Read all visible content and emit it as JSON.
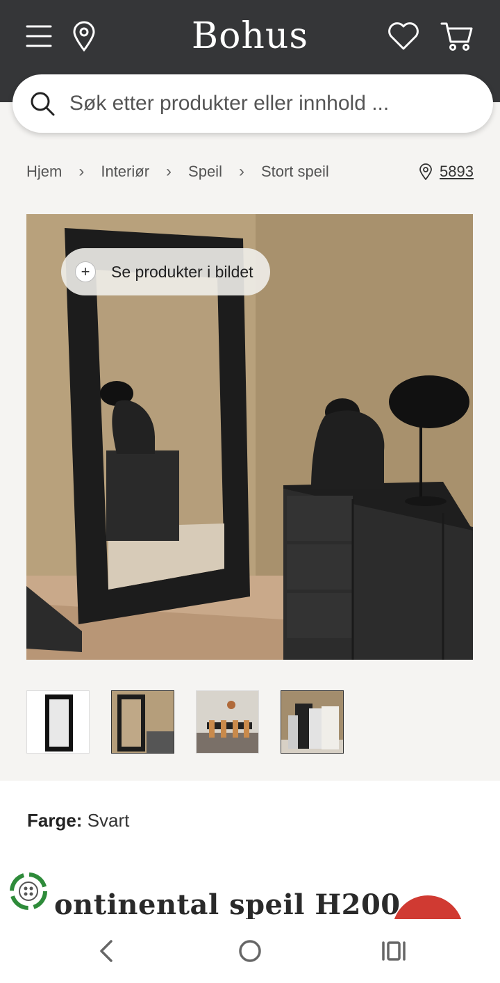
{
  "header": {
    "logo_text": "Bohus",
    "menu_icon": "menu-icon",
    "location_icon": "map-pin-icon",
    "wishlist_icon": "heart-icon",
    "cart_icon": "cart-icon"
  },
  "search": {
    "placeholder": "Søk etter produkter eller innhold ..."
  },
  "breadcrumb": {
    "items": [
      "Hjem",
      "Interiør",
      "Speil",
      "Stort speil"
    ],
    "store_number": "5893"
  },
  "hero": {
    "pill_label": "Se produkter i bildet"
  },
  "product": {
    "color_label": "Farge:",
    "color_value": "Svart",
    "title_visible": "ontinental speil H200"
  },
  "colors": {
    "topbar": "#353638",
    "accent_red": "#d03a32",
    "eco_green": "#2e8b3a"
  }
}
